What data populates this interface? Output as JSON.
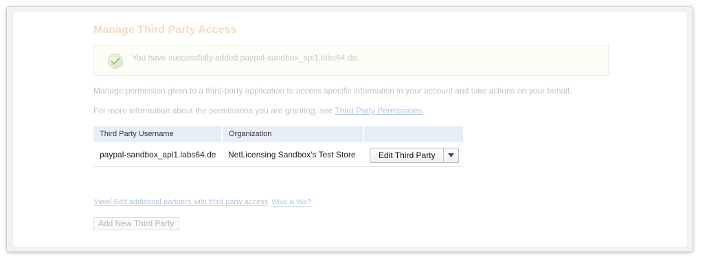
{
  "page": {
    "title": "Manage Third Party Access"
  },
  "alert": {
    "message": "You have successfully added paypal-sandbox_api1.labs64.de.",
    "icon": "check-circle-icon"
  },
  "description": {
    "line1": "Manage permission given to a third-party application to access specific information in your account and take actions on your behalf.",
    "line2_prefix": "For more information about the permissions you are granting, see ",
    "line2_link": "Third Party Permissions",
    "line2_suffix": "."
  },
  "table": {
    "headers": [
      "Third Party Username",
      "Organization",
      ""
    ],
    "rows": [
      {
        "username": "paypal-sandbox_api1.labs64.de",
        "organization": "NetLicensing Sandbox's Test Store",
        "action_label": "Edit Third Party"
      }
    ]
  },
  "footer": {
    "partners_link": "View/ Edit additional partners with third party access",
    "help_link": "What is this?",
    "add_button": "Add New Third Party"
  },
  "colors": {
    "title": "#f3dcc6",
    "link": "#b3c6e4",
    "table_header_bg": "#e6eef8",
    "dropdown_arrow": "#2a4b86"
  }
}
